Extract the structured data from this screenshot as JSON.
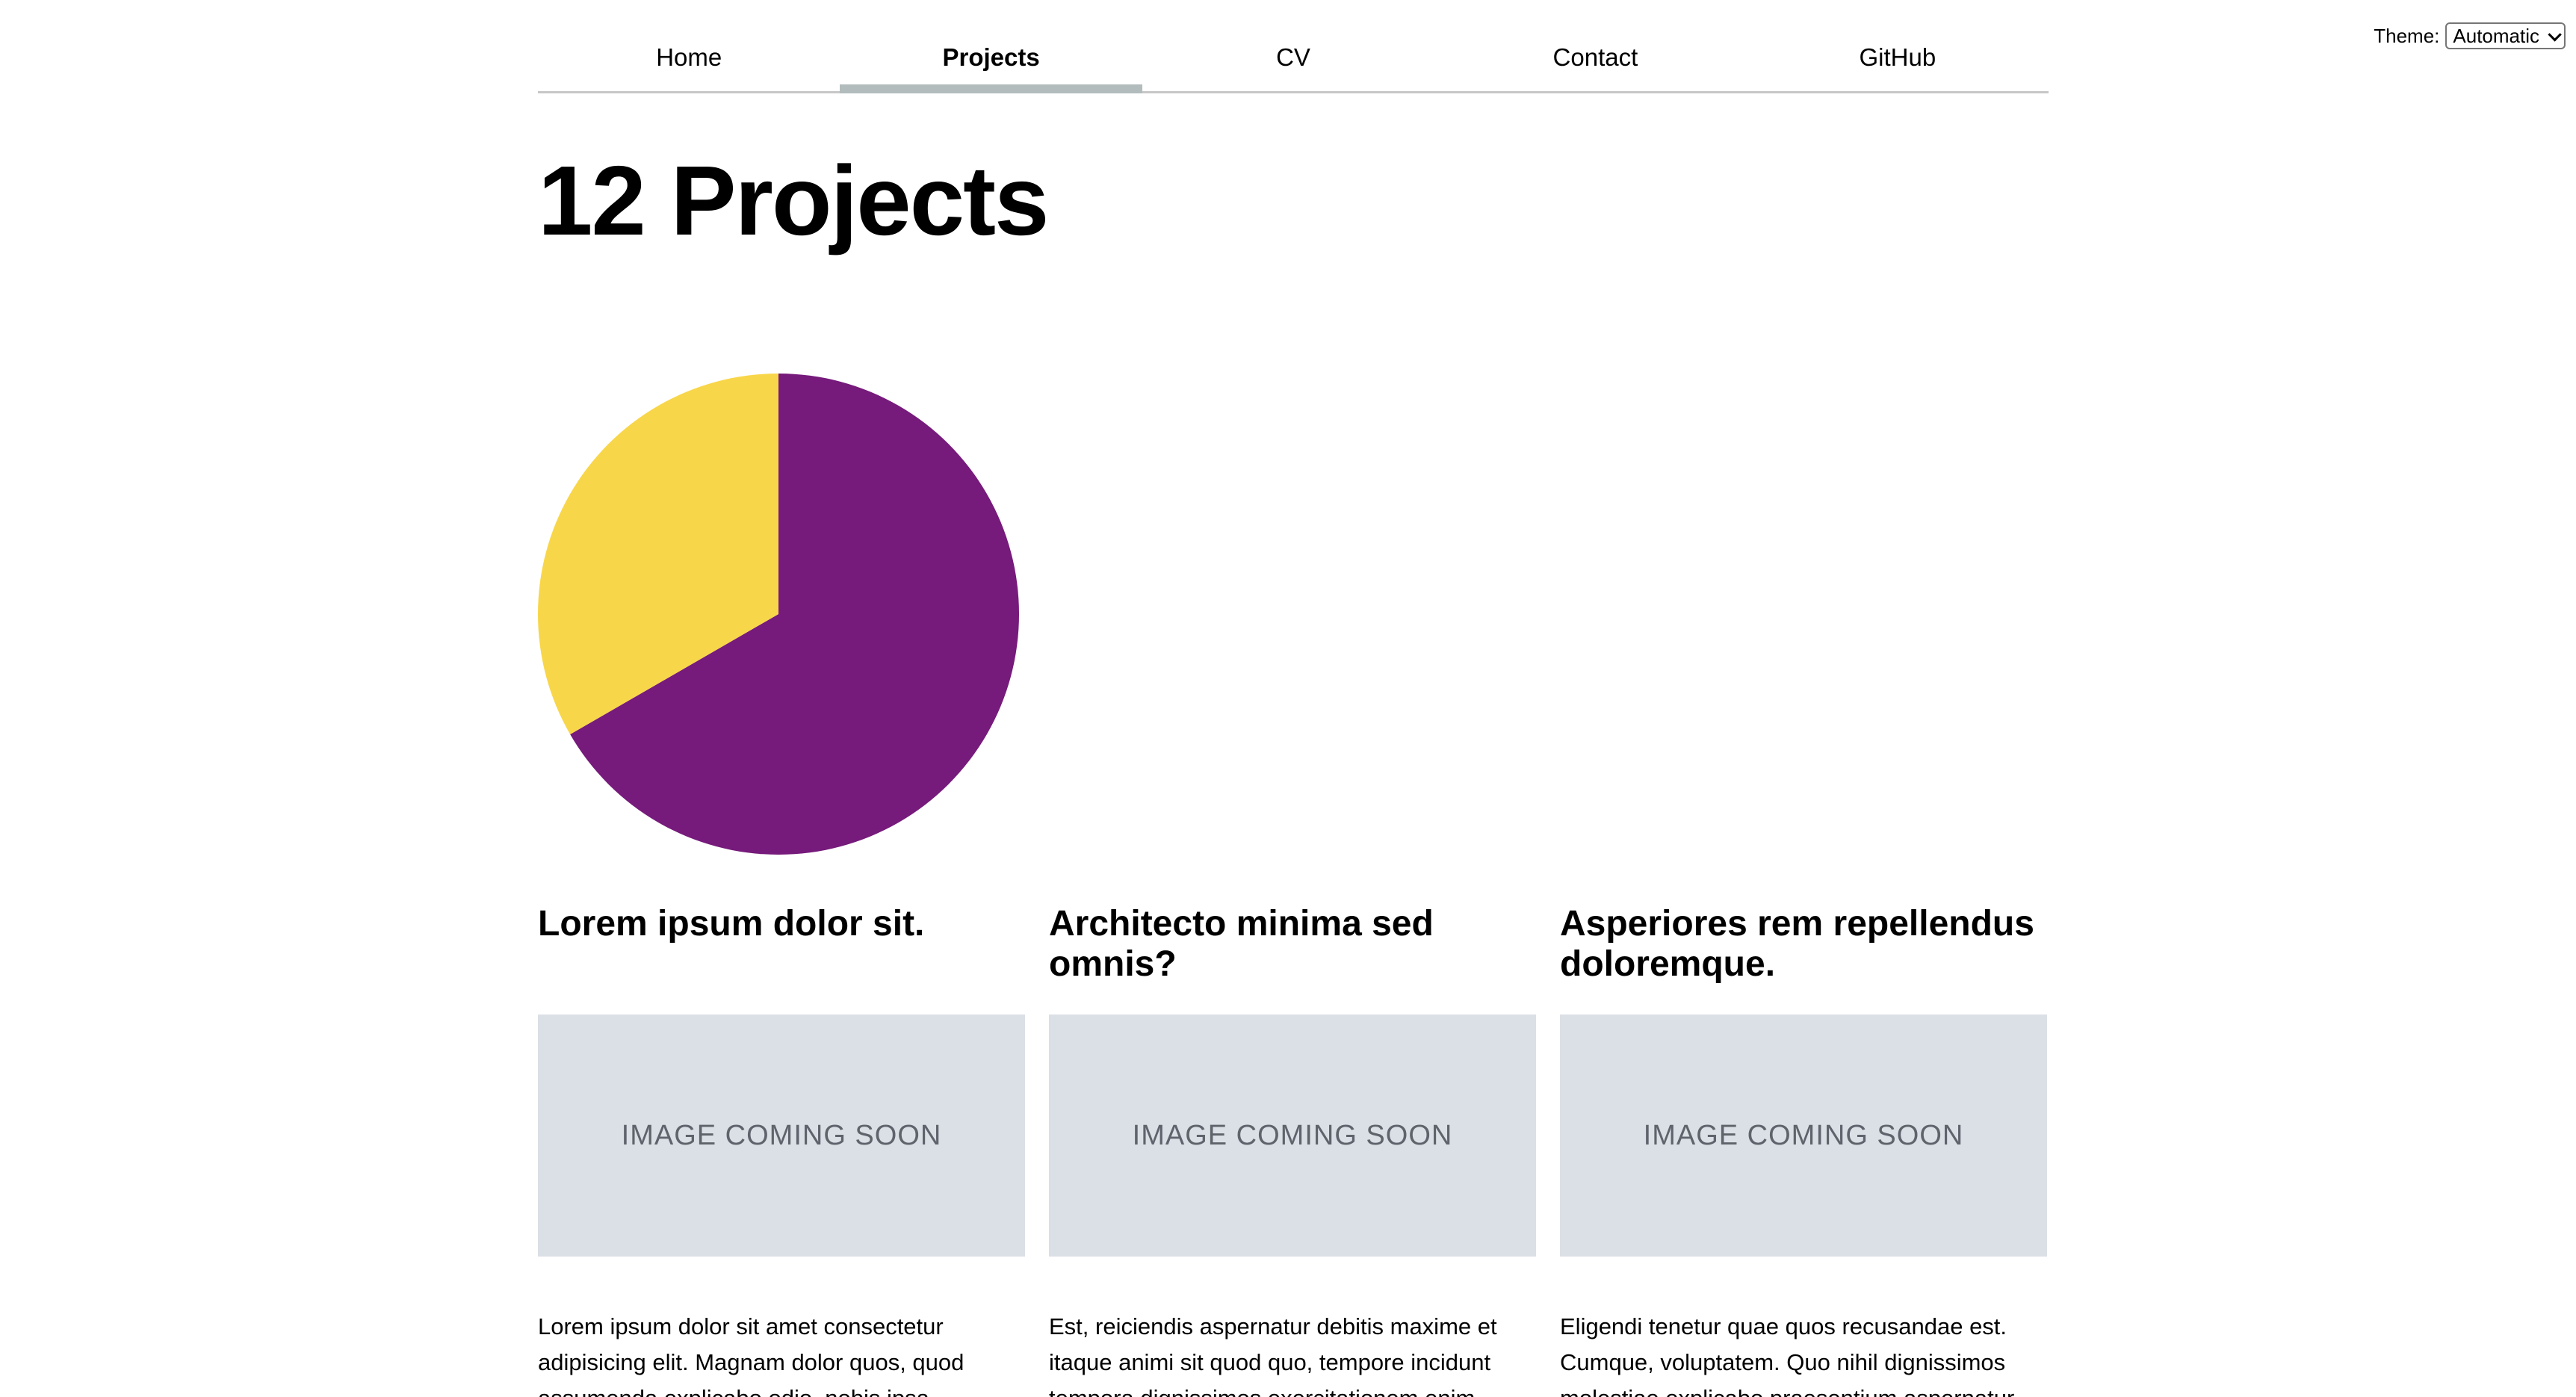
{
  "theme": {
    "label": "Theme:",
    "selected": "Automatic"
  },
  "nav": {
    "items": [
      {
        "label": "Home"
      },
      {
        "label": "Projects"
      },
      {
        "label": "CV"
      },
      {
        "label": "Contact"
      },
      {
        "label": "GitHub"
      }
    ],
    "active": "Projects",
    "active_indicator_color": "#b2bcbc"
  },
  "page": {
    "title": "12 Projects"
  },
  "chart_data": {
    "type": "pie",
    "slices": [
      {
        "value": 2,
        "color": "#761a7b"
      },
      {
        "value": 1,
        "color": "#f8d649"
      }
    ]
  },
  "projects": [
    {
      "title": "Lorem ipsum dolor sit.",
      "image_placeholder": "IMAGE COMING SOON",
      "description": "Lorem ipsum dolor sit amet consectetur adipisicing elit. Magnam dolor quos, quod assumenda explicabo odio, nobis ipsa"
    },
    {
      "title": "Architecto minima sed omnis?",
      "image_placeholder": "IMAGE COMING SOON",
      "description": "Est, reiciendis aspernatur debitis maxime et itaque animi sit quod quo, tempore incidunt tempora dignissimos exercitationem enim"
    },
    {
      "title": "Asperiores rem repellendus doloremque.",
      "image_placeholder": "IMAGE COMING SOON",
      "description": "Eligendi tenetur quae quos recusandae est. Cumque, voluptatem. Quo nihil dignissimos molestiae explicabo praesentium aspernatur"
    }
  ],
  "colors": {
    "image_placeholder_bg": "#dbdfe6",
    "image_placeholder_text": "#5f636b"
  }
}
